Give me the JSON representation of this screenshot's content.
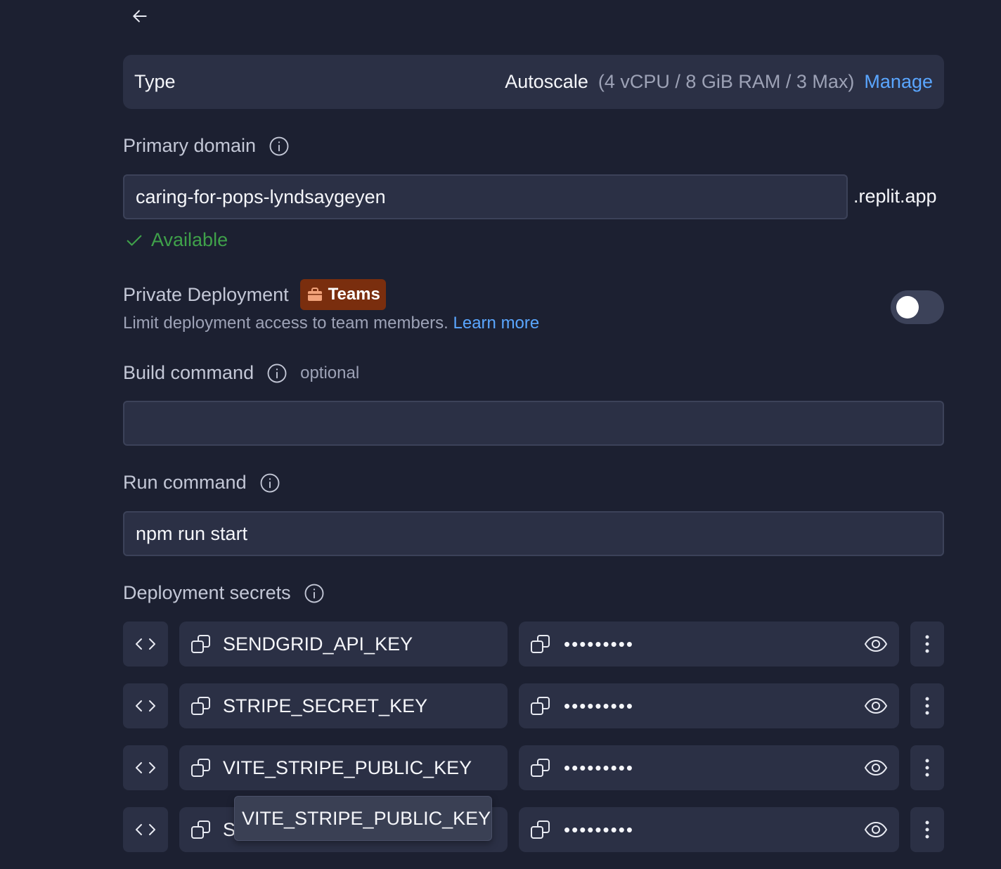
{
  "type_card": {
    "label": "Type",
    "value": "Autoscale",
    "spec": "(4 vCPU / 8 GiB RAM / 3 Max)",
    "manage": "Manage"
  },
  "primary_domain": {
    "label": "Primary domain",
    "value": "caring-for-pops-lyndsaygeyen",
    "suffix": ".replit.app",
    "status": "Available"
  },
  "private_deployment": {
    "label": "Private Deployment",
    "badge": "Teams",
    "description": "Limit deployment access to team members.",
    "learn_more": "Learn more",
    "enabled": false
  },
  "build_command": {
    "label": "Build command",
    "optional": "optional",
    "value": ""
  },
  "run_command": {
    "label": "Run command",
    "value": "npm run start"
  },
  "secrets": {
    "label": "Deployment secrets",
    "masked": "•••••••••",
    "items": [
      {
        "key": "SENDGRID_API_KEY"
      },
      {
        "key": "STRIPE_SECRET_KEY"
      },
      {
        "key": "VITE_STRIPE_PUBLIC_KEY"
      },
      {
        "key": "S"
      }
    ],
    "tooltip": "VITE_STRIPE_PUBLIC_KEY"
  },
  "colors": {
    "background": "#1c2031",
    "card": "#2b3045",
    "accent_link": "#5aa6ff",
    "success": "#3fa14a",
    "teams_badge": "#7a2e0e"
  }
}
